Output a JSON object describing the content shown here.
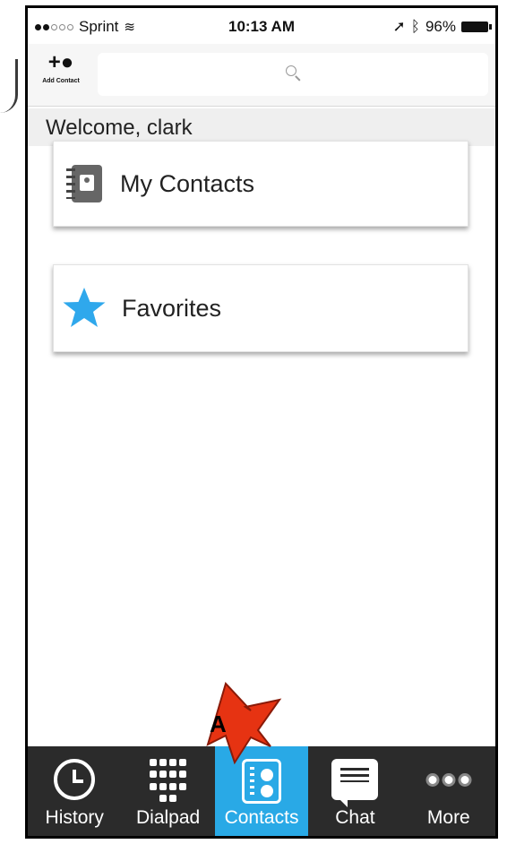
{
  "status_bar": {
    "carrier": "Sprint",
    "time": "10:13 AM",
    "battery": "96%"
  },
  "toolbar": {
    "add_contact_label": "Add Contact"
  },
  "welcome": {
    "text": "Welcome, clark"
  },
  "cards": [
    {
      "label": "My Contacts",
      "icon": "address-book-icon"
    },
    {
      "label": "Favorites",
      "icon": "star-icon"
    }
  ],
  "tab_bar": {
    "active": "Contacts",
    "tabs": [
      {
        "label": "History",
        "icon": "clock-icon"
      },
      {
        "label": "Dialpad",
        "icon": "dialpad-icon"
      },
      {
        "label": "Contacts",
        "icon": "contacts-book-icon"
      },
      {
        "label": "Chat",
        "icon": "chat-icon"
      },
      {
        "label": "More",
        "icon": "more-dots-icon"
      }
    ]
  },
  "annotation": {
    "label": "A"
  },
  "colors": {
    "accent": "#29a9e6",
    "tab_bar_bg": "#2b2b2b",
    "star": "#2fa8ec",
    "callout": "#e63312"
  }
}
